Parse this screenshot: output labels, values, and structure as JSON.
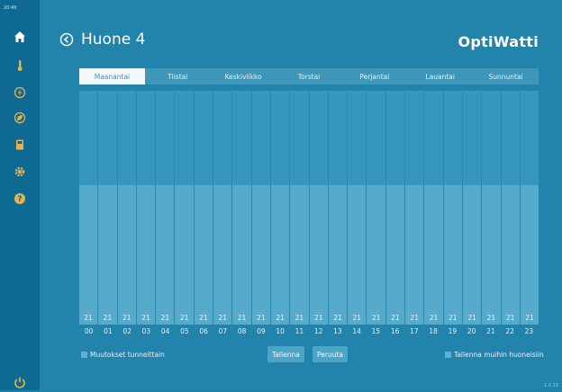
{
  "status": {
    "clock": "20:49",
    "corner_text": "1.0.15"
  },
  "sidebar": {
    "items": [
      {
        "icon": "home-icon"
      },
      {
        "icon": "thermometer-icon"
      },
      {
        "icon": "boost-icon"
      },
      {
        "icon": "eco-icon"
      },
      {
        "icon": "device-icon"
      },
      {
        "icon": "gear-icon"
      },
      {
        "icon": "help-icon"
      }
    ],
    "power_icon": "power-icon"
  },
  "header": {
    "title": "Huone 4",
    "logo": "OptiWatti"
  },
  "tabs": [
    "Maanantai",
    "Tiistai",
    "Keskiviikko",
    "Torstai",
    "Perjantai",
    "Lauantai",
    "Sunnuntai"
  ],
  "active_tab": 0,
  "schedule": {
    "values": [
      "21",
      "21",
      "21",
      "21",
      "21",
      "21",
      "21",
      "21",
      "21",
      "21",
      "21",
      "21",
      "21",
      "21",
      "21",
      "21",
      "21",
      "21",
      "21",
      "21",
      "21",
      "21",
      "21",
      "21"
    ],
    "hours": [
      "00",
      "01",
      "02",
      "03",
      "04",
      "05",
      "06",
      "07",
      "08",
      "09",
      "10",
      "11",
      "12",
      "13",
      "14",
      "15",
      "16",
      "17",
      "18",
      "19",
      "20",
      "21",
      "22",
      "23"
    ]
  },
  "footer": {
    "hourly_changes_label": "Muutokset tunneittain",
    "save_label": "Tallenna",
    "cancel_label": "Peruuta",
    "save_other_rooms_label": "Tallenna muihin huoneisiin"
  },
  "colors": {
    "accent": "#2283ab",
    "sidebar": "#0e6a92",
    "active_tab": "#f2f8fb"
  }
}
